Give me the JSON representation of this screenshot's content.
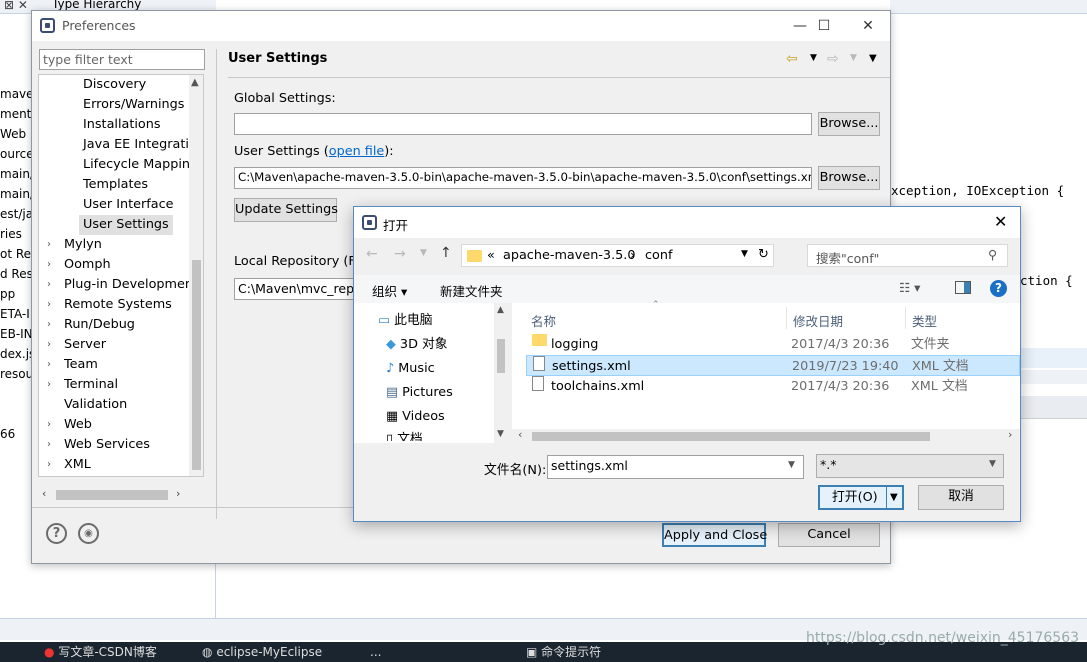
{
  "workspace": {
    "tab_title": "Type Hierarchy",
    "left_fragments": [
      "maven",
      "ment D",
      "Web",
      "ource",
      "main/ja",
      "main/re",
      "est/jav",
      "ries",
      "ot Res",
      "d Res",
      "pp",
      "ETA-I",
      "EB-IN",
      "dex.js",
      "resou",
      "",
      "",
      "66"
    ],
    "code_line_1": "xception, IOException {",
    "code_line_2": "ction {"
  },
  "taskbar": {
    "items": [
      "写文章-CSDN博客",
      "eclipse-MyEclipse",
      "...",
      "命令提示符"
    ],
    "watermark": "https://blog.csdn.net/weixin_45176563"
  },
  "preferences": {
    "title": "Preferences",
    "filter_placeholder": "type filter text",
    "tree": {
      "children": [
        "Discovery",
        "Errors/Warnings",
        "Installations",
        "Java EE Integration",
        "Lifecycle Mapping",
        "Templates",
        "User Interface",
        "User Settings"
      ],
      "top_level": [
        "Mylyn",
        "Oomph",
        "Plug-in Development",
        "Remote Systems",
        "Run/Debug",
        "Server",
        "Team",
        "Terminal",
        "Validation",
        "Web",
        "Web Services",
        "XML"
      ]
    },
    "page_title": "User Settings",
    "global_settings_label": "Global Settings:",
    "global_settings_value": "",
    "browse_label": "Browse...",
    "user_settings_label": "User Settings (",
    "open_file_link": "open file",
    "user_settings_label_end": "):",
    "user_settings_value": "C:\\Maven\\apache-maven-3.5.0-bin\\apache-maven-3.5.0-bin\\apache-maven-3.5.0\\conf\\settings.xml",
    "update_settings_label": "Update Settings",
    "local_repo_label": "Local Repository (Fro",
    "local_repo_value": "C:\\Maven\\mvc_repo",
    "apply_close_label": "Apply and Close",
    "cancel_label": "Cancel"
  },
  "open_dialog": {
    "title": "打开",
    "breadcrumb": [
      "«",
      "apache-maven-3.5.0",
      "›",
      "conf"
    ],
    "search_placeholder": "搜索\"conf\"",
    "organize_label": "组织 ▾",
    "new_folder_label": "新建文件夹",
    "nav_items": [
      "此电脑",
      "3D 对象",
      "Music",
      "Pictures",
      "Videos",
      "文档"
    ],
    "columns": [
      "名称",
      "修改日期",
      "类型"
    ],
    "files": [
      {
        "name": "logging",
        "date": "2017/4/3 20:36",
        "type": "文件夹",
        "kind": "folder"
      },
      {
        "name": "settings.xml",
        "date": "2019/7/23 19:40",
        "type": "XML 文档",
        "kind": "doc"
      },
      {
        "name": "toolchains.xml",
        "date": "2017/4/3 20:36",
        "type": "XML 文档",
        "kind": "doc"
      }
    ],
    "filename_label": "文件名(N):",
    "filename_value": "settings.xml",
    "filter_value": "*.*",
    "open_label": "打开(O)",
    "cancel_label": "取消"
  }
}
